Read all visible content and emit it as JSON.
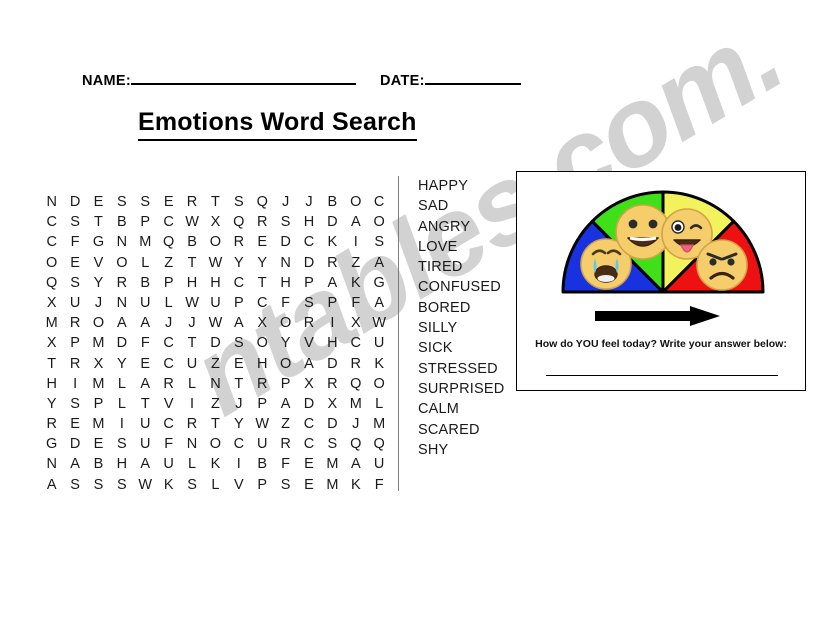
{
  "header": {
    "name_label": "NAME:",
    "date_label": "DATE:"
  },
  "title": "Emotions Word Search",
  "watermark": "ntables.com.",
  "grid": {
    "columns": 15,
    "rows": [
      [
        "N",
        "D",
        "E",
        "S",
        "S",
        "E",
        "R",
        "T",
        "S",
        "Q",
        "J",
        "J",
        "B",
        "O",
        "C"
      ],
      [
        "C",
        "S",
        "T",
        "B",
        "P",
        "C",
        "W",
        "X",
        "Q",
        "R",
        "S",
        "H",
        "D",
        "A",
        "O"
      ],
      [
        "C",
        "F",
        "G",
        "N",
        "M",
        "Q",
        "B",
        "O",
        "R",
        "E",
        "D",
        "C",
        "K",
        "I",
        "S"
      ],
      [
        "O",
        "E",
        "V",
        "O",
        "L",
        "Z",
        "T",
        "W",
        "Y",
        "Y",
        "N",
        "D",
        "R",
        "Z",
        "A"
      ],
      [
        "Q",
        "S",
        "Y",
        "R",
        "B",
        "P",
        "H",
        "H",
        "C",
        "T",
        "H",
        "P",
        "A",
        "K",
        "G"
      ],
      [
        "X",
        "U",
        "J",
        "N",
        "U",
        "L",
        "W",
        "U",
        "P",
        "C",
        "F",
        "S",
        "P",
        "F",
        "A"
      ],
      [
        "M",
        "R",
        "O",
        "A",
        "A",
        "J",
        "J",
        "W",
        "A",
        "X",
        "O",
        "R",
        "I",
        "X",
        "W"
      ],
      [
        "X",
        "P",
        "M",
        "D",
        "F",
        "C",
        "T",
        "D",
        "S",
        "O",
        "Y",
        "V",
        "H",
        "C",
        "U"
      ],
      [
        "T",
        "R",
        "X",
        "Y",
        "E",
        "C",
        "U",
        "Z",
        "E",
        "H",
        "O",
        "A",
        "D",
        "R",
        "K"
      ],
      [
        "H",
        "I",
        "M",
        "L",
        "A",
        "R",
        "L",
        "N",
        "T",
        "R",
        "P",
        "X",
        "R",
        "Q",
        "O"
      ],
      [
        "Y",
        "S",
        "P",
        "L",
        "T",
        "V",
        "I",
        "Z",
        "J",
        "P",
        "A",
        "D",
        "X",
        "M",
        "L"
      ],
      [
        "R",
        "E",
        "M",
        "I",
        "U",
        "C",
        "R",
        "T",
        "Y",
        "W",
        "Z",
        "C",
        "D",
        "J",
        "M"
      ],
      [
        "G",
        "D",
        "E",
        "S",
        "U",
        "F",
        "N",
        "O",
        "C",
        "U",
        "R",
        "C",
        "S",
        "Q",
        "Q"
      ],
      [
        "N",
        "A",
        "B",
        "H",
        "A",
        "U",
        "L",
        "K",
        "I",
        "B",
        "F",
        "E",
        "M",
        "A",
        "U"
      ],
      [
        "A",
        "S",
        "S",
        "S",
        "W",
        "K",
        "S",
        "L",
        "V",
        "P",
        "S",
        "E",
        "M",
        "K",
        "F"
      ]
    ]
  },
  "word_list": [
    "HAPPY",
    "SAD",
    "ANGRY",
    "LOVE",
    "TIRED",
    "CONFUSED",
    "BORED",
    "SILLY",
    "SICK",
    "STRESSED",
    "SURPRISED",
    "CALM",
    "SCARED",
    "SHY"
  ],
  "mood_meter": {
    "caption": "How do YOU feel today? Write your answer below:",
    "answer_value": "",
    "segments": [
      {
        "name": "sad",
        "color": "#1832E0",
        "emoji": "loudly-crying-face"
      },
      {
        "name": "happy",
        "color": "#3FE017",
        "emoji": "grinning-face"
      },
      {
        "name": "silly",
        "color": "#F2F25C",
        "emoji": "winking-face-with-tongue"
      },
      {
        "name": "angry",
        "color": "#EE1111",
        "emoji": "angry-face"
      }
    ],
    "arrow": "right-arrow",
    "face_color": "#F5CE6B",
    "face_outline": "#D1A24A"
  }
}
